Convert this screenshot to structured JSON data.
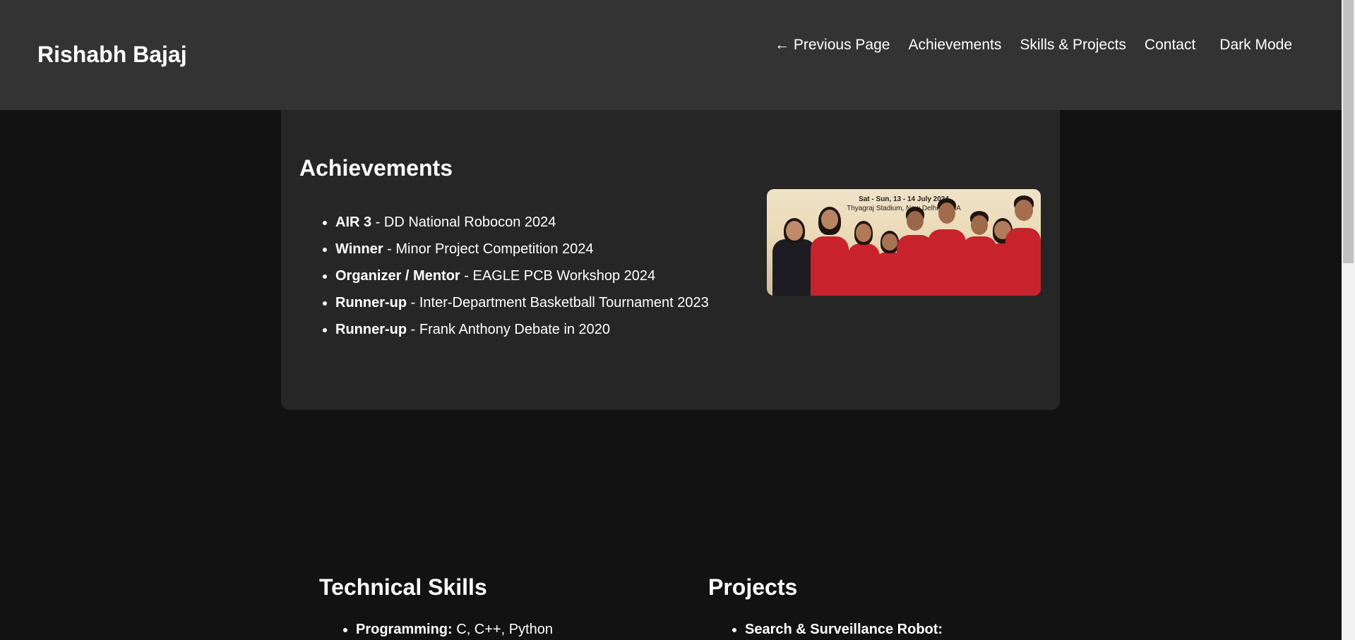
{
  "header": {
    "site_title": "Rishabh Bajaj",
    "nav": {
      "previous": "← Previous Page",
      "achievements": "Achievements",
      "skills_projects": "Skills & Projects",
      "contact": "Contact",
      "dark_mode": "Dark Mode"
    }
  },
  "achievements": {
    "title": "Achievements",
    "items": [
      {
        "strong": "AIR 3",
        "text": " - DD National Robocon 2024"
      },
      {
        "strong": "Winner",
        "text": " - Minor Project Competition 2024"
      },
      {
        "strong": "Organizer / Mentor",
        "text": " - EAGLE PCB Workshop 2024"
      },
      {
        "strong": "Runner-up",
        "text": " - Inter-Department Basketball Tournament 2023"
      },
      {
        "strong": "Runner-up",
        "text": " - Frank Anthony Debate in 2020"
      }
    ],
    "photo": {
      "caption_line1": "Sat - Sun, 13 - 14 July 2024",
      "caption_line2": "Thyagraj Stadium, New Delhi, INDIA"
    }
  },
  "skills": {
    "title": "Technical Skills",
    "items": [
      {
        "strong": "Programming:",
        "text": " C, C++, Python"
      }
    ]
  },
  "projects": {
    "title": "Projects",
    "items": [
      {
        "strong": "Search & Surveillance Robot:",
        "text": ""
      }
    ]
  },
  "colors": {
    "page_bg": "#121212",
    "header_bg": "#333333",
    "card_bg": "#262626",
    "text": "#ffffff",
    "jersey_red": "#c8232c"
  }
}
